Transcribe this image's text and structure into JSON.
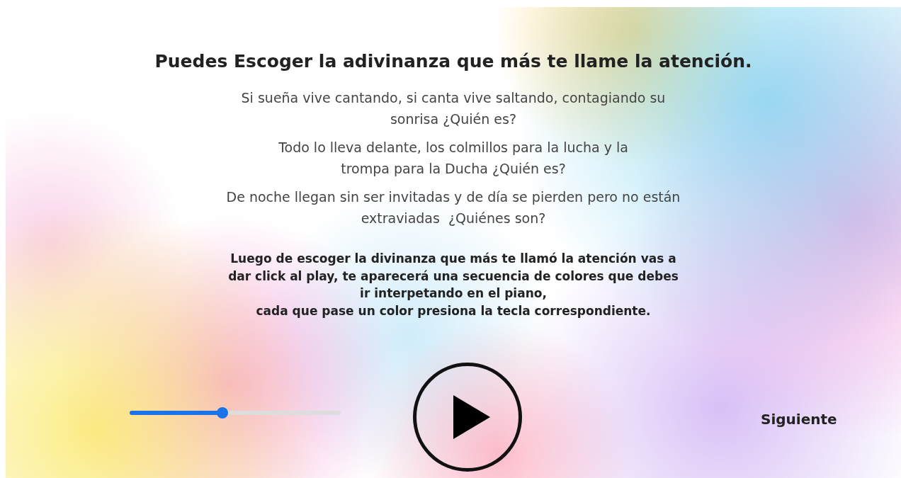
{
  "title": "Puedes Escoger la adivinanza que más te llame la atención.",
  "riddles": [
    "Si sueña vive cantando, si canta vive saltando, contagiando su sonrisa ¿Quién es?",
    "Todo lo lleva delante, los colmillos para la lucha y la trompa para la Ducha ¿Quién es?",
    "De noche llegan sin ser invitadas y de día se pierden pero no están extraviadas  ¿Quiénes son?"
  ],
  "instructions": "Luego de escoger la divinanza que más te llamó la atención vas a dar click al play, te aparecerá una secuencia de colores que debes ir interpetando en el piano,\ncada que pase un color presiona la tecla correspondiente.",
  "volume_slider": {
    "level": 0.44
  },
  "next_link": {
    "label": "Siguiente"
  }
}
